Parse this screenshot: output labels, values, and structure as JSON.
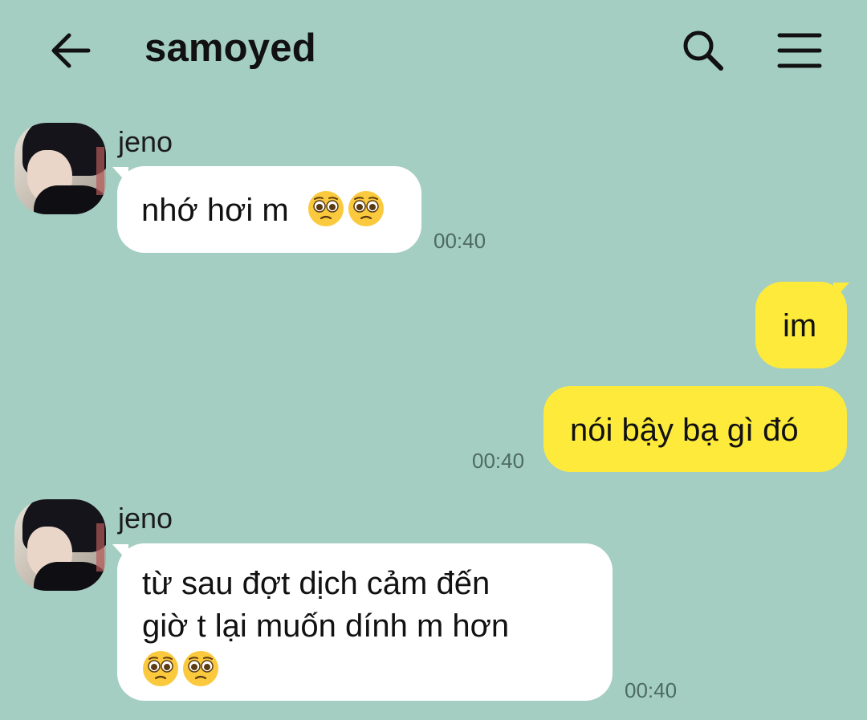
{
  "header": {
    "title": "samoyed",
    "back_icon": "arrow-left-icon",
    "search_icon": "search-icon",
    "menu_icon": "hamburger-menu-icon"
  },
  "colors": {
    "background": "#a5cec2",
    "incoming_bubble": "#ffffff",
    "outgoing_bubble": "#fdea3a",
    "timestamp": "#4d6a63"
  },
  "messages": [
    {
      "direction": "incoming",
      "sender": "jeno",
      "text": "nhớ hơi m",
      "emoji": [
        "pleading-face-emoji",
        "pleading-face-emoji"
      ],
      "time": "00:40"
    },
    {
      "direction": "outgoing",
      "text": "im"
    },
    {
      "direction": "outgoing",
      "text": "nói bậy bạ gì đó",
      "time": "00:40"
    },
    {
      "direction": "incoming",
      "sender": "jeno",
      "lines": [
        "từ sau đợt dịch cảm đến",
        "giờ t lại muốn dính m hơn"
      ],
      "emoji": [
        "pleading-face-emoji",
        "pleading-face-emoji"
      ],
      "time": "00:40"
    }
  ]
}
